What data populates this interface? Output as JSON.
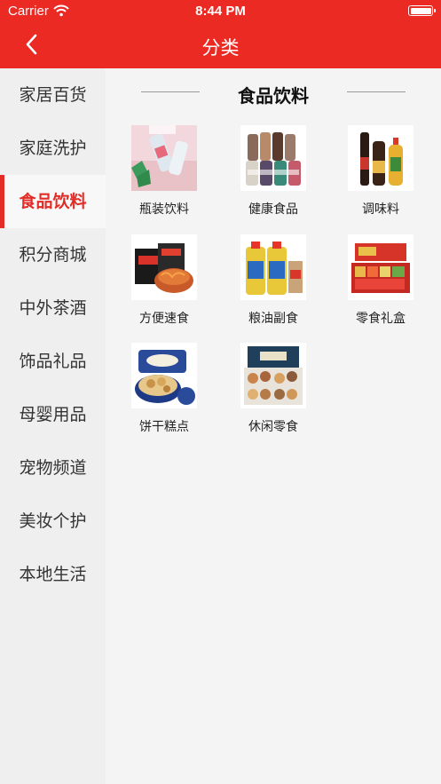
{
  "status_bar": {
    "carrier": "Carrier",
    "time": "8:44 PM"
  },
  "nav": {
    "title": "分类",
    "back_icon": "chevron-left-icon"
  },
  "sidebar": {
    "items": [
      {
        "label": "家居百货"
      },
      {
        "label": "家庭洗护"
      },
      {
        "label": "食品饮料",
        "active": true
      },
      {
        "label": "积分商城"
      },
      {
        "label": "中外茶酒"
      },
      {
        "label": "饰品礼品"
      },
      {
        "label": "母婴用品"
      },
      {
        "label": "宠物频道"
      },
      {
        "label": "美妆个护"
      },
      {
        "label": "本地生活"
      }
    ]
  },
  "main": {
    "section_title": "食品饮料",
    "categories": [
      {
        "label": "瓶装饮料",
        "image": "bottled-drinks"
      },
      {
        "label": "健康食品",
        "image": "health-food-bottles"
      },
      {
        "label": "调味料",
        "image": "seasoning-bottles"
      },
      {
        "label": "方便速食",
        "image": "instant-noodles"
      },
      {
        "label": "粮油副食",
        "image": "cooking-oil"
      },
      {
        "label": "零食礼盒",
        "image": "snack-gift-box"
      },
      {
        "label": "饼干糕点",
        "image": "cookie-tin"
      },
      {
        "label": "休闲零食",
        "image": "nut-snack-box"
      }
    ]
  },
  "colors": {
    "accent": "#ec2a24",
    "active_text": "#e32c26"
  }
}
